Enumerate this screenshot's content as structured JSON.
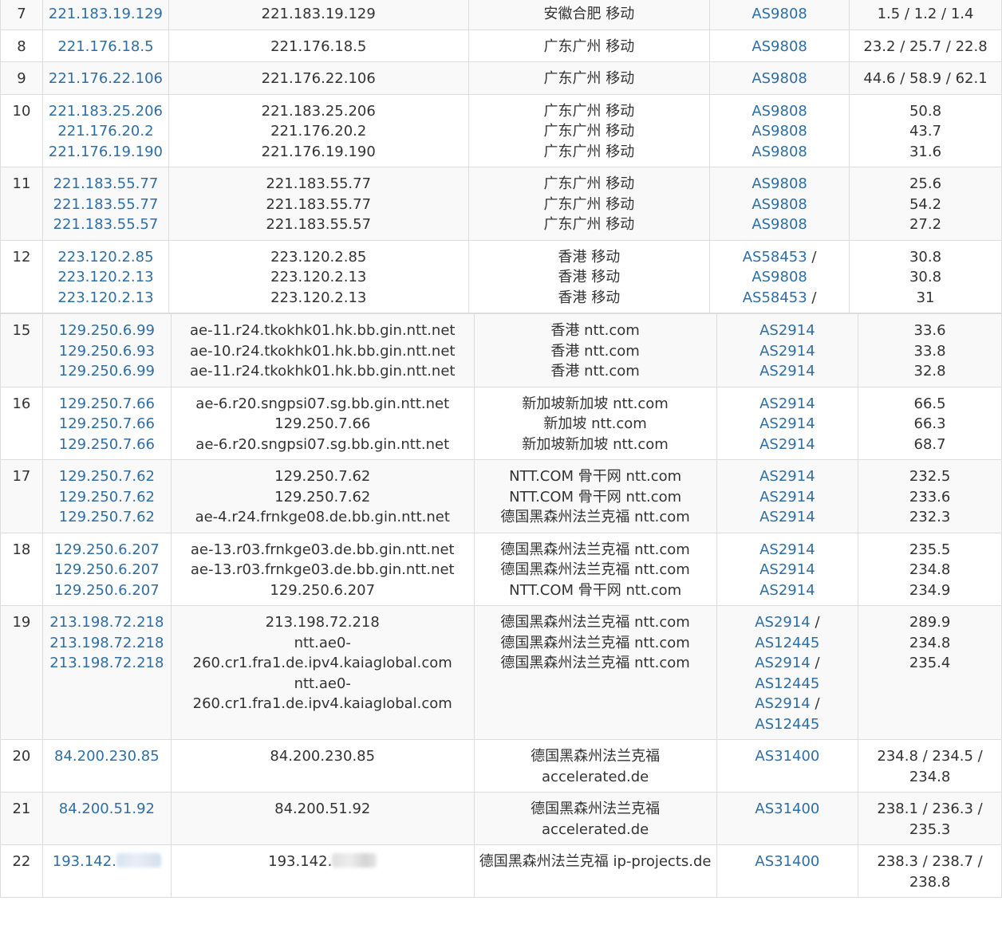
{
  "table_a": {
    "rows": [
      {
        "hop": "7",
        "ip": [
          "221.183.19.129"
        ],
        "host": [
          "221.183.19.129"
        ],
        "loc": [
          "安徽合肥 移动"
        ],
        "asn": [
          "AS9808"
        ],
        "lat": [
          "1.5 / 1.2 / 1.4"
        ]
      },
      {
        "hop": "8",
        "ip": [
          "221.176.18.5"
        ],
        "host": [
          "221.176.18.5"
        ],
        "loc": [
          "广东广州 移动"
        ],
        "asn": [
          "AS9808"
        ],
        "lat": [
          "23.2 / 25.7 / 22.8"
        ]
      },
      {
        "hop": "9",
        "ip": [
          "221.176.22.106"
        ],
        "host": [
          "221.176.22.106"
        ],
        "loc": [
          "广东广州 移动"
        ],
        "asn": [
          "AS9808"
        ],
        "lat": [
          "44.6 / 58.9 / 62.1"
        ]
      },
      {
        "hop": "10",
        "ip": [
          "221.183.25.206",
          "221.176.20.2",
          "221.176.19.190"
        ],
        "host": [
          "221.183.25.206",
          "221.176.20.2",
          "221.176.19.190"
        ],
        "loc": [
          "广东广州 移动",
          "广东广州 移动",
          "广东广州 移动"
        ],
        "asn": [
          "AS9808",
          "AS9808",
          "AS9808"
        ],
        "lat": [
          "50.8",
          "43.7",
          "31.6"
        ]
      },
      {
        "hop": "11",
        "ip": [
          "221.183.55.77",
          "221.183.55.77",
          "221.183.55.57"
        ],
        "host": [
          "221.183.55.77",
          "221.183.55.77",
          "221.183.55.57"
        ],
        "loc": [
          "广东广州 移动",
          "广东广州 移动",
          "广东广州 移动"
        ],
        "asn": [
          "AS9808",
          "AS9808",
          "AS9808"
        ],
        "lat": [
          "25.6",
          "54.2",
          "27.2"
        ]
      },
      {
        "hop": "12",
        "ip": [
          "223.120.2.85",
          "223.120.2.13",
          "223.120.2.13"
        ],
        "host": [
          "223.120.2.85",
          "223.120.2.13",
          "223.120.2.13"
        ],
        "loc": [
          "香港 移动",
          "香港 移动",
          "香港 移动"
        ],
        "asn": [
          "AS58453",
          "AS9808",
          "AS58453"
        ],
        "lat": [
          "30.8",
          "30.8",
          "31"
        ]
      }
    ]
  },
  "table_b": {
    "rows": [
      {
        "hop": "15",
        "ip": [
          "129.250.6.99",
          "129.250.6.93",
          "129.250.6.99"
        ],
        "host": [
          "ae-11.r24.tkokhk01.hk.bb.gin.ntt.net",
          "ae-10.r24.tkokhk01.hk.bb.gin.ntt.net",
          "ae-11.r24.tkokhk01.hk.bb.gin.ntt.net"
        ],
        "loc": [
          "香港 ntt.com",
          "香港 ntt.com",
          "香港 ntt.com"
        ],
        "asn": [
          "AS2914",
          "AS2914",
          "AS2914"
        ],
        "lat": [
          "33.6",
          "33.8",
          "32.8"
        ]
      },
      {
        "hop": "16",
        "ip": [
          "129.250.7.66",
          "129.250.7.66",
          "129.250.7.66"
        ],
        "host": [
          "ae-6.r20.sngpsi07.sg.bb.gin.ntt.net",
          "129.250.7.66",
          "ae-6.r20.sngpsi07.sg.bb.gin.ntt.net"
        ],
        "loc": [
          "新加坡新加坡 ntt.com",
          "新加坡 ntt.com",
          "新加坡新加坡 ntt.com"
        ],
        "asn": [
          "AS2914",
          "AS2914",
          "AS2914"
        ],
        "lat": [
          "66.5",
          "66.3",
          "68.7"
        ]
      },
      {
        "hop": "17",
        "ip": [
          "129.250.7.62",
          "129.250.7.62",
          "129.250.7.62"
        ],
        "host": [
          "129.250.7.62",
          "129.250.7.62",
          "ae-4.r24.frnkge08.de.bb.gin.ntt.net"
        ],
        "loc": [
          "NTT.COM 骨干网 ntt.com",
          "NTT.COM 骨干网 ntt.com",
          "德国黑森州法兰克福 ntt.com"
        ],
        "asn": [
          "AS2914",
          "AS2914",
          "AS2914"
        ],
        "lat": [
          "232.5",
          "233.6",
          "232.3"
        ]
      },
      {
        "hop": "18",
        "ip": [
          "129.250.6.207",
          "129.250.6.207",
          "129.250.6.207"
        ],
        "host": [
          "ae-13.r03.frnkge03.de.bb.gin.ntt.net",
          "ae-13.r03.frnkge03.de.bb.gin.ntt.net",
          "129.250.6.207"
        ],
        "loc": [
          "德国黑森州法兰克福 ntt.com",
          "德国黑森州法兰克福 ntt.com",
          "NTT.COM 骨干网 ntt.com"
        ],
        "asn": [
          "AS2914",
          "AS2914",
          "AS2914"
        ],
        "lat": [
          "235.5",
          "234.8",
          "234.9"
        ]
      },
      {
        "hop": "19",
        "ip": [
          "213.198.72.218",
          "213.198.72.218",
          "213.198.72.218"
        ],
        "host": [
          "213.198.72.218",
          "ntt.ae0-",
          "260.cr1.fra1.de.ipv4.kaiaglobal.com",
          "ntt.ae0-",
          "260.cr1.fra1.de.ipv4.kaiaglobal.com"
        ],
        "loc": [
          "德国黑森州法兰克福 ntt.com",
          "德国黑森州法兰克福 ntt.com",
          "德国黑森州法兰克福 ntt.com"
        ],
        "asn": [
          "AS2914",
          "AS12445",
          "AS2914",
          "AS12445",
          "AS2914",
          "AS12445"
        ],
        "lat": [
          "289.9",
          "234.8",
          "235.4"
        ]
      },
      {
        "hop": "20",
        "ip": [
          "84.200.230.85"
        ],
        "host": [
          "84.200.230.85"
        ],
        "loc": [
          "德国黑森州法兰克福",
          "accelerated.de"
        ],
        "asn": [
          "AS31400"
        ],
        "lat": [
          "234.8 / 234.5 /",
          "234.8"
        ]
      },
      {
        "hop": "21",
        "ip": [
          "84.200.51.92"
        ],
        "host": [
          "84.200.51.92"
        ],
        "loc": [
          "德国黑森州法兰克福",
          "accelerated.de"
        ],
        "asn": [
          "AS31400"
        ],
        "lat": [
          "238.1 / 236.3 /",
          "235.3"
        ]
      },
      {
        "hop": "22",
        "ip": [
          "193.142."
        ],
        "host": [
          "193.142."
        ],
        "loc": [
          "德国黑森州法兰克福 ip-projects.de"
        ],
        "asn": [
          "AS31400"
        ],
        "lat": [
          "238.3 / 238.7 /",
          "238.8"
        ]
      }
    ]
  }
}
